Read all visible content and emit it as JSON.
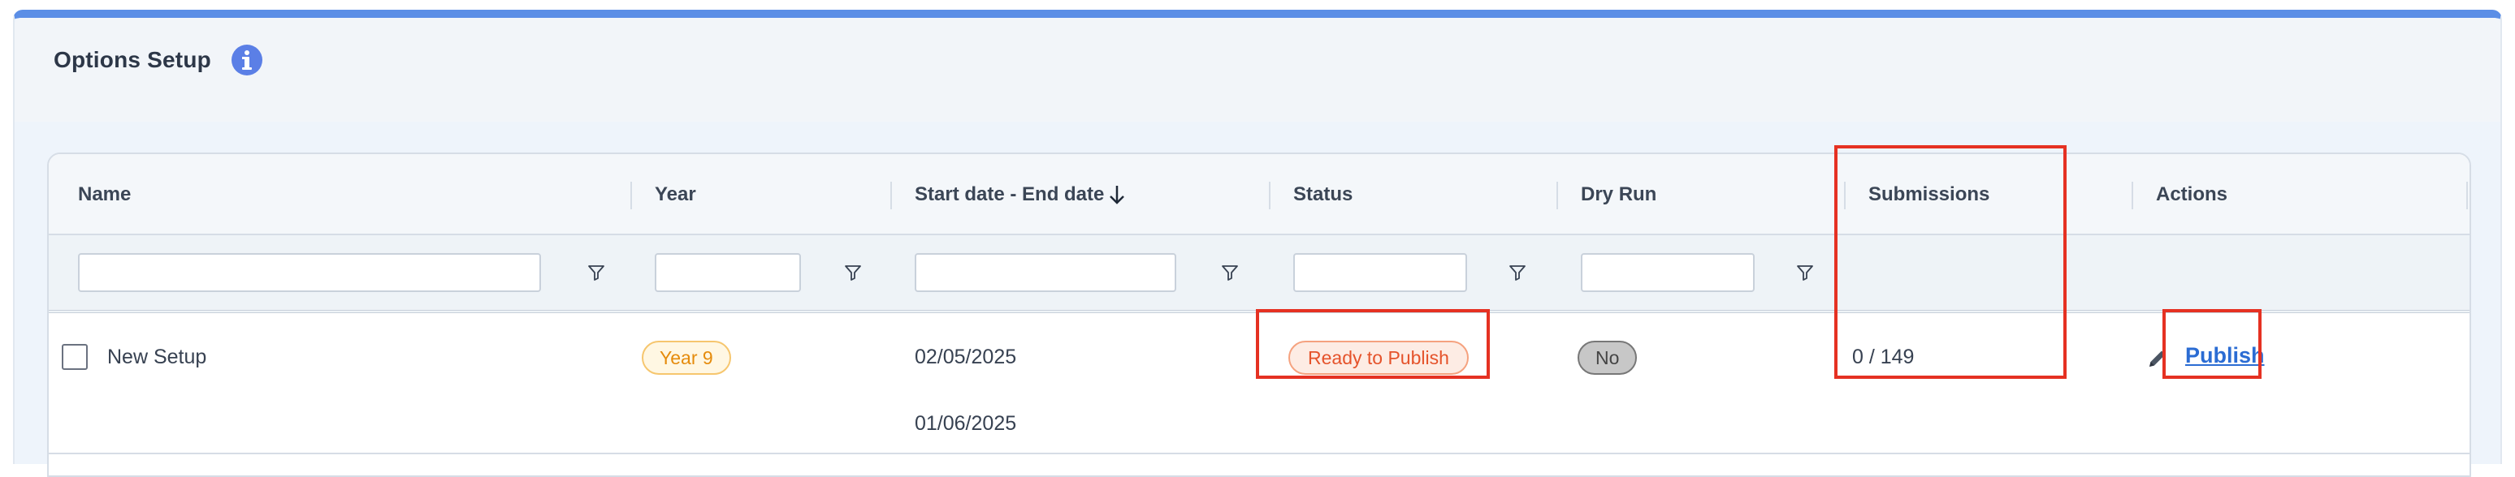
{
  "panel": {
    "title": "Options Setup",
    "info_icon": "info-circle-icon",
    "accent_color": "#5b8ee6"
  },
  "table": {
    "columns": [
      {
        "key": "name",
        "label": "Name",
        "filterable": true
      },
      {
        "key": "year",
        "label": "Year",
        "filterable": true
      },
      {
        "key": "dates",
        "label": "Start date - End date",
        "filterable": true,
        "sort": "descending"
      },
      {
        "key": "status",
        "label": "Status",
        "filterable": true
      },
      {
        "key": "dry_run",
        "label": "Dry Run",
        "filterable": true
      },
      {
        "key": "submissions",
        "label": "Submissions",
        "filterable": false
      },
      {
        "key": "actions",
        "label": "Actions",
        "filterable": false
      }
    ],
    "filters": {
      "name": "",
      "year": "",
      "dates": "",
      "status": "",
      "dry_run": ""
    },
    "rows": [
      {
        "checked": false,
        "name": "New Setup",
        "year": "Year 9",
        "start_date": "02/05/2025",
        "end_date": "01/06/2025",
        "status": "Ready to Publish",
        "dry_run": "No",
        "submissions": "0 / 149",
        "action_label": "Publish",
        "edit_icon": "pencil-icon"
      }
    ]
  },
  "colors": {
    "highlight": "#e53122",
    "year_badge": "#e58b0c",
    "status_badge": "#e5532b",
    "link": "#2b6cd3"
  }
}
